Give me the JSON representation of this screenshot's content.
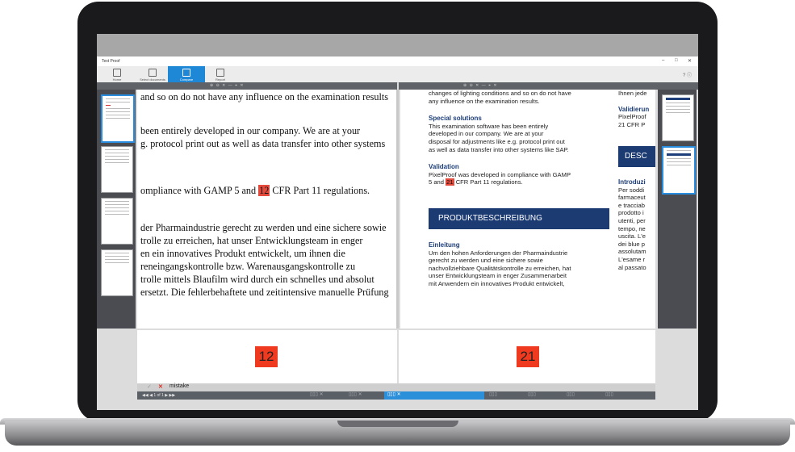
{
  "app": {
    "title": "Text Proof",
    "window_controls": [
      "–",
      "□",
      "✕"
    ],
    "help_icons": "? ⓘ"
  },
  "workflow": [
    {
      "label": "Home",
      "icon": "home-icon",
      "active": false
    },
    {
      "label": "Select documents",
      "icon": "document-icon",
      "active": false
    },
    {
      "label": "Compare",
      "icon": "compare-icon",
      "active": true
    },
    {
      "label": "Report",
      "icon": "report-icon",
      "active": false
    }
  ],
  "toolbar_icons": "⊕ ⊖ ✕ — ⌖ ✕",
  "left_doc": {
    "lines": [
      "and so on do not have any influence on the examination results",
      "been entirely developed in our company. We are at your",
      "g. protocol print out as well as data transfer into other systems",
      "ompliance with GAMP 5 and ",
      " CFR Part 11 regulations.",
      "der Pharmaindustrie gerecht zu werden und eine sichere sowie",
      "trolle zu erreichen, hat unser Entwicklungsteam in enger",
      "en ein innovatives Produkt entwickelt, um ihnen die",
      "reneingangskontrolle bzw. Warenausgangskontrolle zu",
      "trolle mittels Blaufilm wird durch ein schnelles und absolut",
      "ersetzt. Die fehlerbehaftete und zeitintensive manuelle Prüfung"
    ],
    "highlight": "12"
  },
  "right_doc": {
    "intro": [
      "changes of lighting conditions and so on do not have",
      "any influence on the examination results."
    ],
    "special_title": "Special solutions",
    "special": [
      "This examination software has been entirely",
      "developed in our company. We are at your",
      "disposal for adjustments like e.g. protocol print out",
      "as well as data transfer into other systems like SAP."
    ],
    "validation_title": "Validation",
    "validation_1": "PixelProof was developed in compliance with GAMP",
    "validation_2a": "5 and ",
    "validation_highlight": "21",
    "validation_2b": " CFR Part 11 regulations.",
    "banner": "PRODUKTBESCHREIBUNG",
    "einleitung_title": "Einleitung",
    "einleitung": [
      "Um den hohen Anforderungen der Pharmaindustrie",
      "gerecht zu werden und eine sichere sowie",
      "nachvollziehbare Qualitätskontrolle zu erreichen, hat",
      "unser Entwicklungsteam in enger Zusammenarbeit",
      "mit Anwendern ein innovatives Produkt entwickelt,"
    ],
    "col2_top": "Ihnen jede",
    "col2_valid_title": "Validierun",
    "col2_valid": [
      "PixelProof",
      "21 CFR P"
    ],
    "col2_banner": "DESC",
    "col2_intro_title": "Introduzi",
    "col2_intro": [
      "Per soddi",
      "farmaceut",
      "e tracciab",
      "prodotto i",
      "utenti, per",
      "tempo, ne",
      "uscita. L'e",
      "dei blue p",
      "assolutam",
      "L'esame r",
      "al passato"
    ]
  },
  "compare": {
    "left_value": "12",
    "right_value": "21"
  },
  "correction": {
    "check": "✓",
    "cross": "✕",
    "label": "mistake"
  },
  "status": {
    "nav": "◀◀ ◀ 1 of 1 ▶ ▶▶"
  },
  "difference_tabs": [
    "▯▯▯ ✕",
    "▯▯▯ ✕",
    "▯▯▯ ✕",
    "▯▯▯",
    "▯▯▯",
    "▯▯▯",
    "▯▯▯"
  ],
  "colors": {
    "accent": "#1e88d6",
    "highlight": "#ef3a1f",
    "banner": "#1d3b73"
  }
}
